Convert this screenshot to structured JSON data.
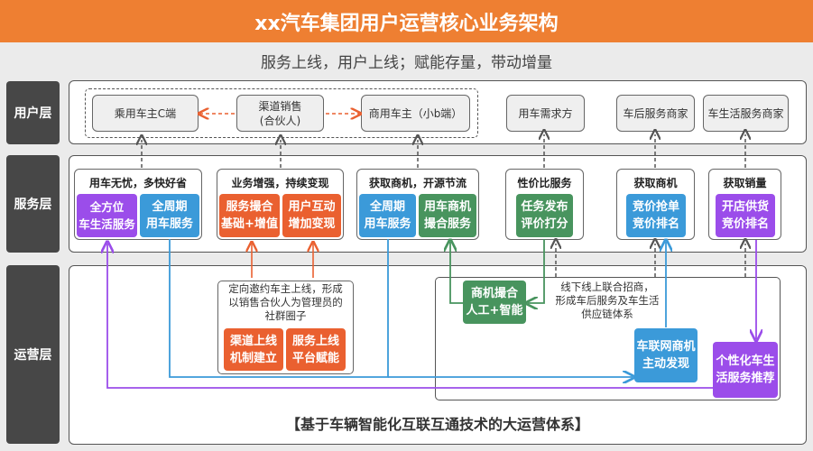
{
  "header": {
    "title": "xx汽车集团用户运营核心业务架构",
    "subtitle": "服务上线，用户上线；赋能存量，带动增量"
  },
  "layers": {
    "user": "用户层",
    "service": "服务层",
    "operation": "运营层"
  },
  "user_layer": {
    "passenger_owner": "乘用车主C端",
    "channel_sales": "渠道销售\n(合伙人)",
    "commercial_owner": "商用车主（小b端）",
    "vehicle_demand": "用车需求方",
    "aftermarket_merchant": "车后服务商家",
    "life_merchant": "车生活服务商家"
  },
  "service_layer": {
    "groups": [
      {
        "title": "用车无忧，多快好省",
        "tiles": [
          {
            "text": "全方位\n车生活服务",
            "color": "purple"
          },
          {
            "text": "全周期\n用车服务",
            "color": "blue"
          }
        ]
      },
      {
        "title": "业务增强，持续变现",
        "tiles": [
          {
            "text": "服务撮合\n基础+增值",
            "color": "orange"
          },
          {
            "text": "用户互动\n增加变现",
            "color": "orange"
          }
        ]
      },
      {
        "title": "获取商机，开源节流",
        "tiles": [
          {
            "text": "全周期\n用车服务",
            "color": "blue"
          },
          {
            "text": "用车商机\n撮合服务",
            "color": "green"
          }
        ]
      },
      {
        "title": "性价比服务",
        "tiles": [
          {
            "text": "任务发布\n评价打分",
            "color": "green"
          }
        ]
      },
      {
        "title": "获取商机",
        "tiles": [
          {
            "text": "竞价抢单\n竞价排名",
            "color": "blue"
          }
        ]
      },
      {
        "title": "获取销量",
        "tiles": [
          {
            "text": "开店供货\n竞价排名",
            "color": "purple"
          }
        ]
      }
    ]
  },
  "operation_layer": {
    "community_note": "定向邀约车主上线，形成\n以销售合伙人为管理员的\n社群圈子",
    "channel_online": "渠道上线\n机制建立",
    "service_online": "服务上线\n平台赋能",
    "matching": "商机撮合\n人工+智能",
    "supply_chain_note": "线下线上联合招商，\n形成车后服务及车生活\n供应链体系",
    "iov_discovery": "车联网商机\n主动发现",
    "personalized": "个性化车生\n活服务推荐",
    "footer": "【基于车辆智能化互联互通技术的大运营体系】"
  },
  "colors": {
    "title_bg": "#ee7f32",
    "purple": "#9b4dea",
    "blue": "#3b9ad9",
    "orange": "#ea6030",
    "green": "#48945e",
    "layer_label_bg": "#474747"
  }
}
